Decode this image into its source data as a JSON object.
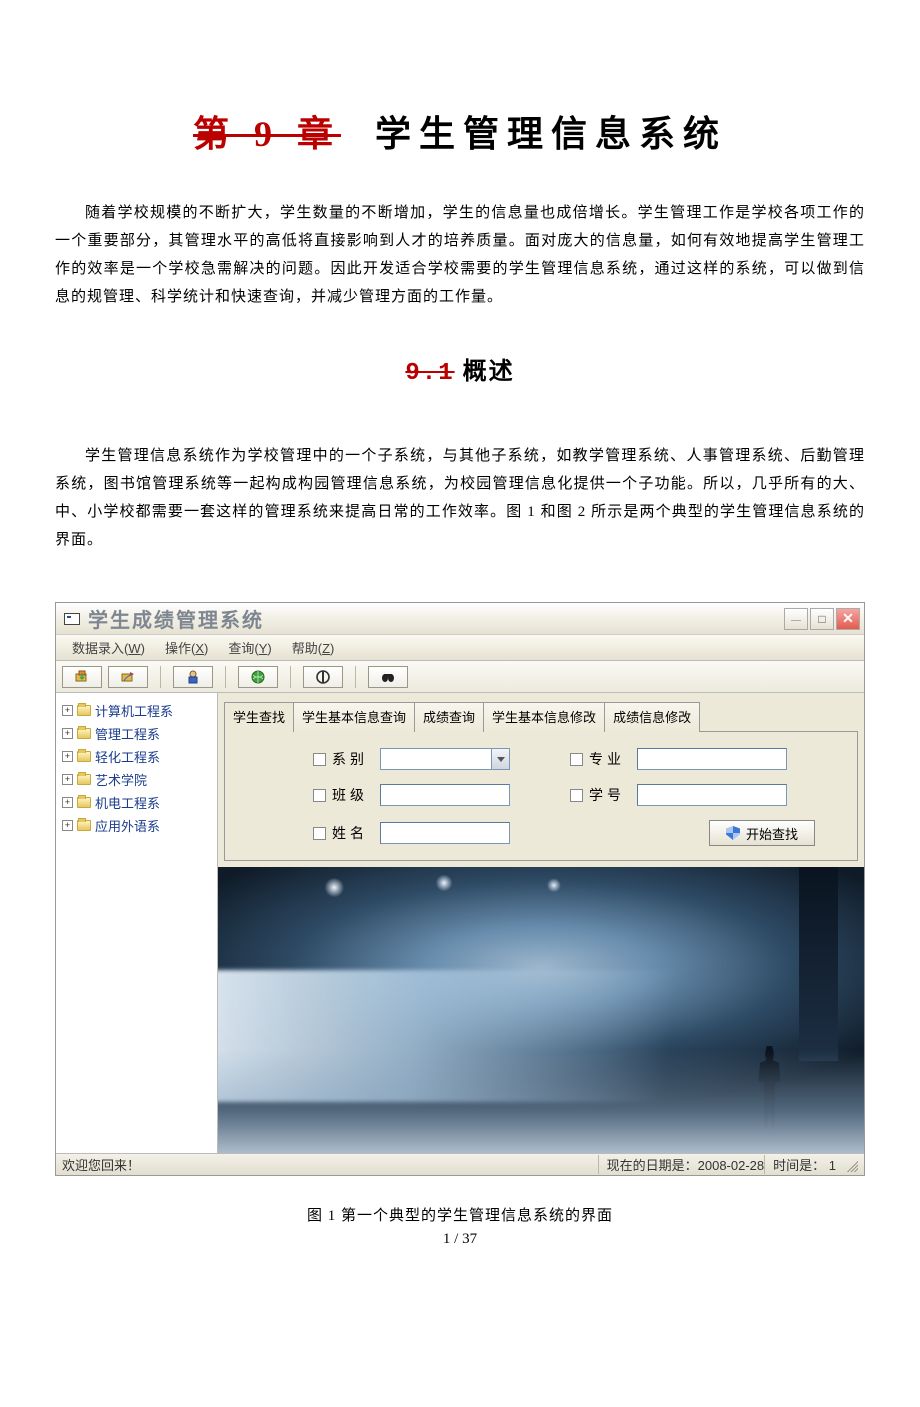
{
  "doc": {
    "chapter_number": "第 9 章",
    "chapter_title": "学生管理信息系统",
    "intro_para": "随着学校规模的不断扩大，学生数量的不断增加，学生的信息量也成倍增长。学生管理工作是学校各项工作的一个重要部分，其管理水平的高低将直接影响到人才的培养质量。面对庞大的信息量，如何有效地提高学生管理工作的效率是一个学校急需解决的问题。因此开发适合学校需要的学生管理信息系统，通过这样的系统，可以做到信息的规管理、科学统计和快速查询，并减少管理方面的工作量。",
    "section_number": "9.1",
    "section_title": "概述",
    "section_para": "学生管理信息系统作为学校管理中的一个子系统，与其他子系统，如教学管理系统、人事管理系统、后勤管理系统，图书馆管理系统等一起构成构园管理信息系统，为校园管理信息化提供一个子功能。所以，几乎所有的大、中、小学校都需要一套这样的管理系统来提高日常的工作效率。图 1 和图 2 所示是两个典型的学生管理信息系统的界面。",
    "figure_caption": "图 1 第一个典型的学生管理信息系统的界面",
    "page_number": "1 / 37"
  },
  "app": {
    "title": "学生成绩管理系统",
    "menus": [
      {
        "label": "数据录入",
        "key": "W"
      },
      {
        "label": "操作",
        "key": "X"
      },
      {
        "label": "查询",
        "key": "Y"
      },
      {
        "label": "帮助",
        "key": "Z"
      }
    ],
    "tree": [
      "计算机工程系",
      "管理工程系",
      "轻化工程系",
      "艺术学院",
      "机电工程系",
      "应用外语系"
    ],
    "tabs": [
      "学生查找",
      "学生基本信息查询",
      "成绩查询",
      "学生基本信息修改",
      "成绩信息修改"
    ],
    "fields": {
      "dept": "系别",
      "major": "专业",
      "class": "班级",
      "sid": "学号",
      "name": "姓名"
    },
    "start_search": "开始查找",
    "status": {
      "welcome": "欢迎您回来！",
      "date_label": "现在的日期是：",
      "date_value": "2008-02-28",
      "time_label": "时间是：",
      "time_value": "1"
    }
  }
}
